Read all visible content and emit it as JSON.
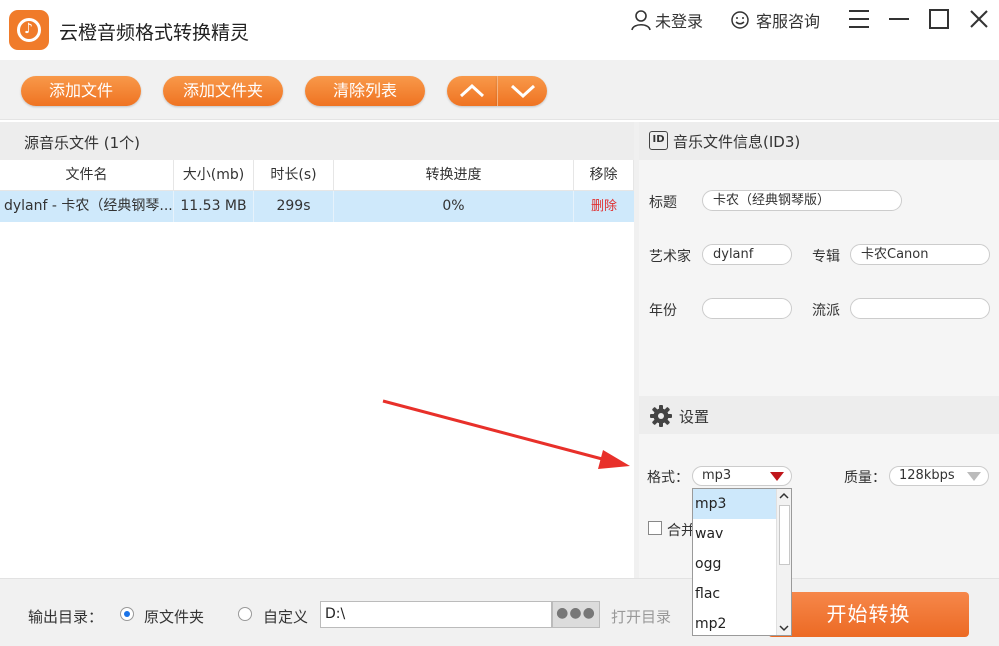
{
  "app": {
    "title": "云橙音频格式转换精灵",
    "login": "未登录",
    "service": "客服咨询"
  },
  "toolbar": {
    "add_file": "添加文件",
    "add_folder": "添加文件夹",
    "clear_list": "清除列表"
  },
  "file_list": {
    "title": "源音乐文件 (1个)",
    "columns": [
      "文件名",
      "大小(mb)",
      "时长(s)",
      "转换进度",
      "移除"
    ],
    "rows": [
      {
        "name": "dylanf - 卡农（经典钢琴...",
        "size": "11.53 MB",
        "duration": "299s",
        "progress": "0%",
        "remove": "删除"
      }
    ]
  },
  "info": {
    "id_badge": "ID",
    "title": "音乐文件信息(ID3)",
    "title_label": "标题",
    "title_value": "卡农（经典钢琴版）",
    "artist_label": "艺术家",
    "artist_value": "dylanf",
    "album_label": "专辑",
    "album_value": "卡农Canon",
    "year_label": "年份",
    "year_value": "",
    "genre_label": "流派",
    "genre_value": ""
  },
  "settings": {
    "title": "设置",
    "format_label": "格式：",
    "format_value": "mp3",
    "quality_label": "质量：",
    "quality_value": "128kbps",
    "merge_label": "合并",
    "format_options": [
      "mp3",
      "wav",
      "ogg",
      "flac",
      "mp2"
    ]
  },
  "bottom": {
    "output_label": "输出目录：",
    "option_original": "原文件夹",
    "option_custom": "自定义",
    "path_value": "D:\\",
    "browse_label": "●●●",
    "open_dir": "打开目录",
    "start": "开始转换"
  },
  "colors": {
    "accent": "#f07b2a",
    "selected_row": "#cfe9fb",
    "delete_text": "#e03030",
    "annotation_arrow": "#e8302a"
  }
}
